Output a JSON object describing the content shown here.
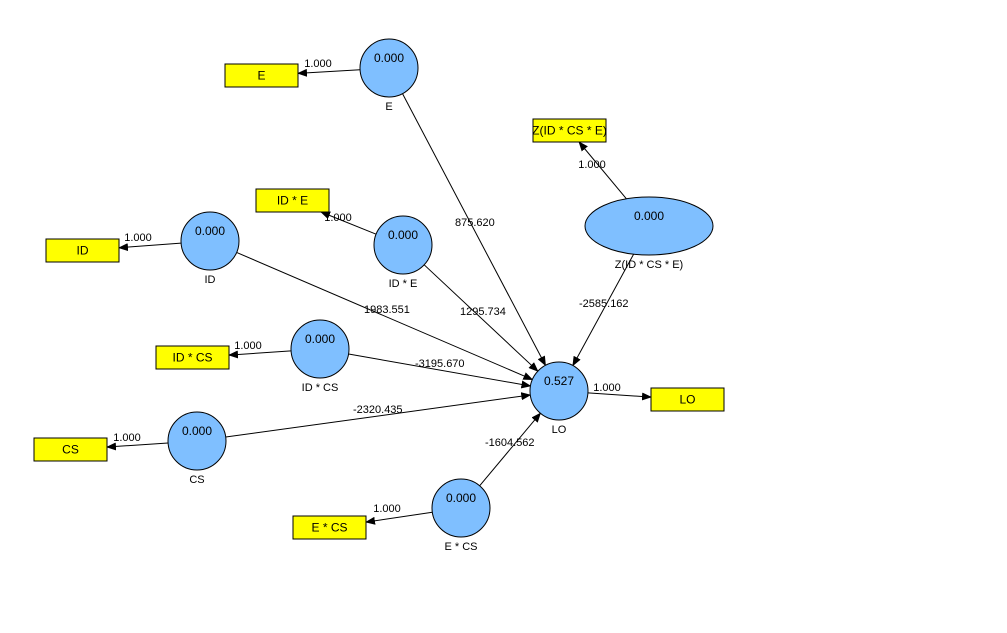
{
  "diagram": {
    "title": "",
    "colors": {
      "latent_fill": "#7fbfff",
      "indicator_fill": "#ffff00",
      "stroke": "#000000",
      "background": "#ffffff"
    },
    "latents": [
      {
        "id": "E",
        "label": "E",
        "r2": "0.000"
      },
      {
        "id": "ID",
        "label": "ID",
        "r2": "0.000"
      },
      {
        "id": "IDxE",
        "label": "ID * E",
        "r2": "0.000"
      },
      {
        "id": "IDxCS",
        "label": "ID * CS",
        "r2": "0.000"
      },
      {
        "id": "CS",
        "label": "CS",
        "r2": "0.000"
      },
      {
        "id": "ExCS",
        "label": "E * CS",
        "r2": "0.000"
      },
      {
        "id": "Z",
        "label": "Z(ID * CS * E)",
        "r2": "0.000"
      },
      {
        "id": "LO",
        "label": "LO",
        "r2": "0.527"
      }
    ],
    "indicators": [
      {
        "id": "ind_E",
        "label": "E",
        "of": "E",
        "loading": "1.000"
      },
      {
        "id": "ind_IDxE",
        "label": "ID * E",
        "of": "IDxE",
        "loading": "1.000"
      },
      {
        "id": "ind_ID",
        "label": "ID",
        "of": "ID",
        "loading": "1.000"
      },
      {
        "id": "ind_IDxCS",
        "label": "ID * CS",
        "of": "IDxCS",
        "loading": "1.000"
      },
      {
        "id": "ind_CS",
        "label": "CS",
        "of": "CS",
        "loading": "1.000"
      },
      {
        "id": "ind_ExCS",
        "label": "E * CS",
        "of": "ExCS",
        "loading": "1.000"
      },
      {
        "id": "ind_Z",
        "label": "Z(ID * CS * E)",
        "of": "Z",
        "loading": "1.000"
      },
      {
        "id": "ind_LO",
        "label": "LO",
        "of": "LO",
        "loading": "1.000"
      }
    ],
    "paths": [
      {
        "from": "E",
        "to": "LO",
        "coef": "875.620"
      },
      {
        "from": "IDxE",
        "to": "LO",
        "coef": "1295.734"
      },
      {
        "from": "ID",
        "to": "LO",
        "coef": "1983.551"
      },
      {
        "from": "IDxCS",
        "to": "LO",
        "coef": "-3195.670"
      },
      {
        "from": "CS",
        "to": "LO",
        "coef": "-2320.435"
      },
      {
        "from": "ExCS",
        "to": "LO",
        "coef": "-1604.562"
      },
      {
        "from": "Z",
        "to": "LO",
        "coef": "-2585.162"
      }
    ]
  }
}
